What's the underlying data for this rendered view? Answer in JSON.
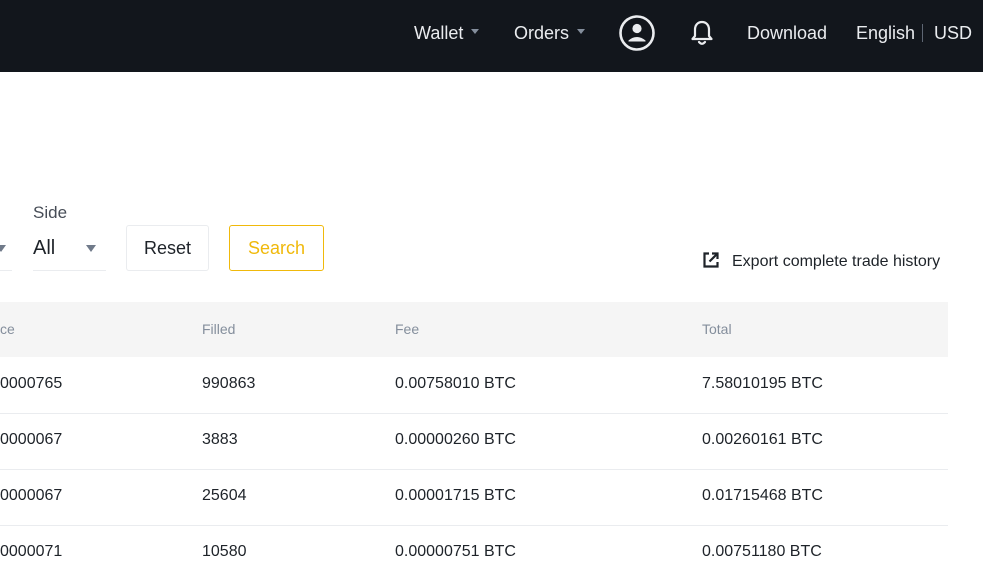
{
  "nav": {
    "wallet": "Wallet",
    "orders": "Orders",
    "download": "Download",
    "language": "English",
    "currency": "USD"
  },
  "filters": {
    "side_label": "Side",
    "side_value": "All",
    "reset_label": "Reset",
    "search_label": "Search"
  },
  "export_label": "Export complete trade history",
  "table": {
    "headers": {
      "price": "ce",
      "filled": "Filled",
      "fee": "Fee",
      "total": "Total"
    },
    "rows": [
      {
        "price": "0000765",
        "filled": "990863",
        "fee": "0.00758010 BTC",
        "total": "7.58010195 BTC"
      },
      {
        "price": "0000067",
        "filled": "3883",
        "fee": "0.00000260 BTC",
        "total": "0.00260161 BTC"
      },
      {
        "price": "0000067",
        "filled": "25604",
        "fee": "0.00001715 BTC",
        "total": "0.01715468 BTC"
      },
      {
        "price": "0000071",
        "filled": "10580",
        "fee": "0.00000751 BTC",
        "total": "0.00751180 BTC"
      }
    ]
  },
  "colors": {
    "header_bg": "#12161c",
    "accent": "#f0b90b"
  },
  "icons": {
    "user": "user-circle-icon",
    "bell": "bell-icon",
    "export": "external-link-icon"
  }
}
